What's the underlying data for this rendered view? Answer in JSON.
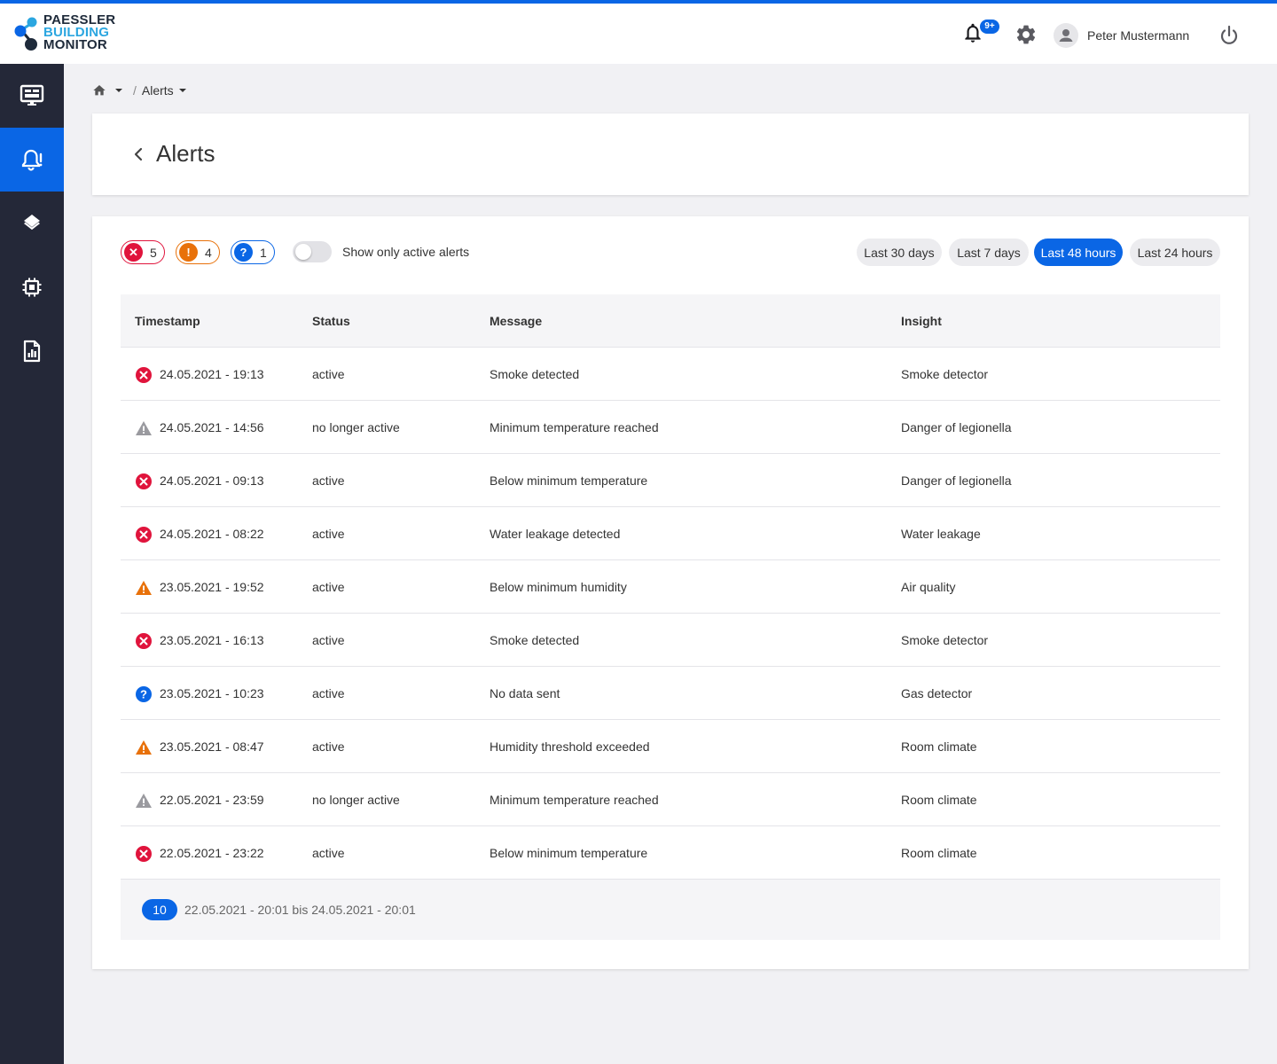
{
  "app": {
    "logo_lines": [
      "PAESSLER",
      "BUILDING",
      "MONITOR"
    ]
  },
  "header": {
    "notif_badge": "9+",
    "user_name": "Peter Mustermann"
  },
  "sidebar": {
    "items": [
      {
        "icon": "dashboard-icon",
        "active": false
      },
      {
        "icon": "alerts-bell-icon",
        "active": true
      },
      {
        "icon": "layers-icon",
        "active": false
      },
      {
        "icon": "chip-icon",
        "active": false
      },
      {
        "icon": "report-icon",
        "active": false
      }
    ]
  },
  "breadcrumb": {
    "current": "Alerts"
  },
  "page": {
    "title": "Alerts"
  },
  "filters": {
    "error_count": "5",
    "warning_count": "4",
    "unknown_count": "1",
    "toggle_label": "Show only active alerts",
    "toggle_on": false,
    "ranges": [
      "Last 30 days",
      "Last 7 days",
      "Last 48 hours",
      "Last 24 hours"
    ],
    "active_range": "Last 48 hours"
  },
  "table": {
    "columns": [
      "Timestamp",
      "Status",
      "Message",
      "Insight"
    ],
    "rows": [
      {
        "severity": "error",
        "timestamp": "24.05.2021 - 19:13",
        "status": "active",
        "message": "Smoke detected",
        "insight": "Smoke detector"
      },
      {
        "severity": "inactive-warning",
        "timestamp": "24.05.2021 - 14:56",
        "status": "no longer active",
        "message": "Minimum temperature reached",
        "insight": "Danger of legionella"
      },
      {
        "severity": "error",
        "timestamp": "24.05.2021 - 09:13",
        "status": "active",
        "message": "Below minimum temperature",
        "insight": "Danger of legionella"
      },
      {
        "severity": "error",
        "timestamp": "24.05.2021 - 08:22",
        "status": "active",
        "message": "Water leakage detected",
        "insight": "Water leakage"
      },
      {
        "severity": "warning",
        "timestamp": "23.05.2021 - 19:52",
        "status": "active",
        "message": "Below minimum humidity",
        "insight": "Air quality"
      },
      {
        "severity": "error",
        "timestamp": "23.05.2021 - 16:13",
        "status": "active",
        "message": "Smoke detected",
        "insight": "Smoke detector"
      },
      {
        "severity": "unknown",
        "timestamp": "23.05.2021 - 10:23",
        "status": "active",
        "message": "No data sent",
        "insight": "Gas detector"
      },
      {
        "severity": "warning",
        "timestamp": "23.05.2021 - 08:47",
        "status": "active",
        "message": "Humidity threshold exceeded",
        "insight": "Room climate"
      },
      {
        "severity": "inactive-warning",
        "timestamp": "22.05.2021 - 23:59",
        "status": "no longer active",
        "message": "Minimum temperature reached",
        "insight": "Room climate"
      },
      {
        "severity": "error",
        "timestamp": "22.05.2021 - 23:22",
        "status": "active",
        "message": "Below minimum temperature",
        "insight": "Room climate"
      }
    ],
    "footer_count": "10",
    "footer_range": "22.05.2021 - 20:01 bis 24.05.2021 - 20:01"
  },
  "colors": {
    "accent": "#0a66e5",
    "error": "#e0143c",
    "warning": "#e8710a",
    "inactive": "#9a9a9f",
    "sidebar": "#242838"
  }
}
